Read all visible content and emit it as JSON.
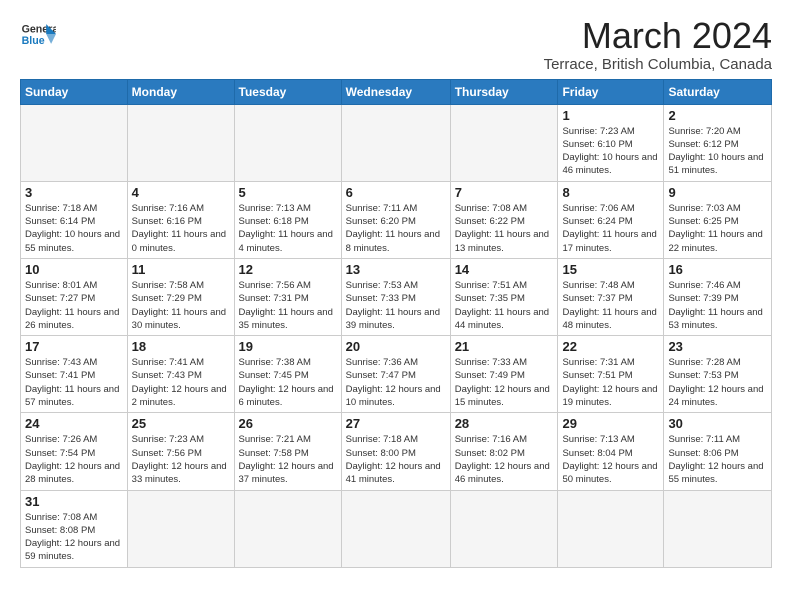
{
  "header": {
    "logo_general": "General",
    "logo_blue": "Blue",
    "month_title": "March 2024",
    "subtitle": "Terrace, British Columbia, Canada"
  },
  "weekdays": [
    "Sunday",
    "Monday",
    "Tuesday",
    "Wednesday",
    "Thursday",
    "Friday",
    "Saturday"
  ],
  "weeks": [
    [
      {
        "day": "",
        "info": ""
      },
      {
        "day": "",
        "info": ""
      },
      {
        "day": "",
        "info": ""
      },
      {
        "day": "",
        "info": ""
      },
      {
        "day": "",
        "info": ""
      },
      {
        "day": "1",
        "info": "Sunrise: 7:23 AM\nSunset: 6:10 PM\nDaylight: 10 hours and 46 minutes."
      },
      {
        "day": "2",
        "info": "Sunrise: 7:20 AM\nSunset: 6:12 PM\nDaylight: 10 hours and 51 minutes."
      }
    ],
    [
      {
        "day": "3",
        "info": "Sunrise: 7:18 AM\nSunset: 6:14 PM\nDaylight: 10 hours and 55 minutes."
      },
      {
        "day": "4",
        "info": "Sunrise: 7:16 AM\nSunset: 6:16 PM\nDaylight: 11 hours and 0 minutes."
      },
      {
        "day": "5",
        "info": "Sunrise: 7:13 AM\nSunset: 6:18 PM\nDaylight: 11 hours and 4 minutes."
      },
      {
        "day": "6",
        "info": "Sunrise: 7:11 AM\nSunset: 6:20 PM\nDaylight: 11 hours and 8 minutes."
      },
      {
        "day": "7",
        "info": "Sunrise: 7:08 AM\nSunset: 6:22 PM\nDaylight: 11 hours and 13 minutes."
      },
      {
        "day": "8",
        "info": "Sunrise: 7:06 AM\nSunset: 6:24 PM\nDaylight: 11 hours and 17 minutes."
      },
      {
        "day": "9",
        "info": "Sunrise: 7:03 AM\nSunset: 6:25 PM\nDaylight: 11 hours and 22 minutes."
      }
    ],
    [
      {
        "day": "10",
        "info": "Sunrise: 8:01 AM\nSunset: 7:27 PM\nDaylight: 11 hours and 26 minutes."
      },
      {
        "day": "11",
        "info": "Sunrise: 7:58 AM\nSunset: 7:29 PM\nDaylight: 11 hours and 30 minutes."
      },
      {
        "day": "12",
        "info": "Sunrise: 7:56 AM\nSunset: 7:31 PM\nDaylight: 11 hours and 35 minutes."
      },
      {
        "day": "13",
        "info": "Sunrise: 7:53 AM\nSunset: 7:33 PM\nDaylight: 11 hours and 39 minutes."
      },
      {
        "day": "14",
        "info": "Sunrise: 7:51 AM\nSunset: 7:35 PM\nDaylight: 11 hours and 44 minutes."
      },
      {
        "day": "15",
        "info": "Sunrise: 7:48 AM\nSunset: 7:37 PM\nDaylight: 11 hours and 48 minutes."
      },
      {
        "day": "16",
        "info": "Sunrise: 7:46 AM\nSunset: 7:39 PM\nDaylight: 11 hours and 53 minutes."
      }
    ],
    [
      {
        "day": "17",
        "info": "Sunrise: 7:43 AM\nSunset: 7:41 PM\nDaylight: 11 hours and 57 minutes."
      },
      {
        "day": "18",
        "info": "Sunrise: 7:41 AM\nSunset: 7:43 PM\nDaylight: 12 hours and 2 minutes."
      },
      {
        "day": "19",
        "info": "Sunrise: 7:38 AM\nSunset: 7:45 PM\nDaylight: 12 hours and 6 minutes."
      },
      {
        "day": "20",
        "info": "Sunrise: 7:36 AM\nSunset: 7:47 PM\nDaylight: 12 hours and 10 minutes."
      },
      {
        "day": "21",
        "info": "Sunrise: 7:33 AM\nSunset: 7:49 PM\nDaylight: 12 hours and 15 minutes."
      },
      {
        "day": "22",
        "info": "Sunrise: 7:31 AM\nSunset: 7:51 PM\nDaylight: 12 hours and 19 minutes."
      },
      {
        "day": "23",
        "info": "Sunrise: 7:28 AM\nSunset: 7:53 PM\nDaylight: 12 hours and 24 minutes."
      }
    ],
    [
      {
        "day": "24",
        "info": "Sunrise: 7:26 AM\nSunset: 7:54 PM\nDaylight: 12 hours and 28 minutes."
      },
      {
        "day": "25",
        "info": "Sunrise: 7:23 AM\nSunset: 7:56 PM\nDaylight: 12 hours and 33 minutes."
      },
      {
        "day": "26",
        "info": "Sunrise: 7:21 AM\nSunset: 7:58 PM\nDaylight: 12 hours and 37 minutes."
      },
      {
        "day": "27",
        "info": "Sunrise: 7:18 AM\nSunset: 8:00 PM\nDaylight: 12 hours and 41 minutes."
      },
      {
        "day": "28",
        "info": "Sunrise: 7:16 AM\nSunset: 8:02 PM\nDaylight: 12 hours and 46 minutes."
      },
      {
        "day": "29",
        "info": "Sunrise: 7:13 AM\nSunset: 8:04 PM\nDaylight: 12 hours and 50 minutes."
      },
      {
        "day": "30",
        "info": "Sunrise: 7:11 AM\nSunset: 8:06 PM\nDaylight: 12 hours and 55 minutes."
      }
    ],
    [
      {
        "day": "31",
        "info": "Sunrise: 7:08 AM\nSunset: 8:08 PM\nDaylight: 12 hours and 59 minutes."
      },
      {
        "day": "",
        "info": ""
      },
      {
        "day": "",
        "info": ""
      },
      {
        "day": "",
        "info": ""
      },
      {
        "day": "",
        "info": ""
      },
      {
        "day": "",
        "info": ""
      },
      {
        "day": "",
        "info": ""
      }
    ]
  ]
}
